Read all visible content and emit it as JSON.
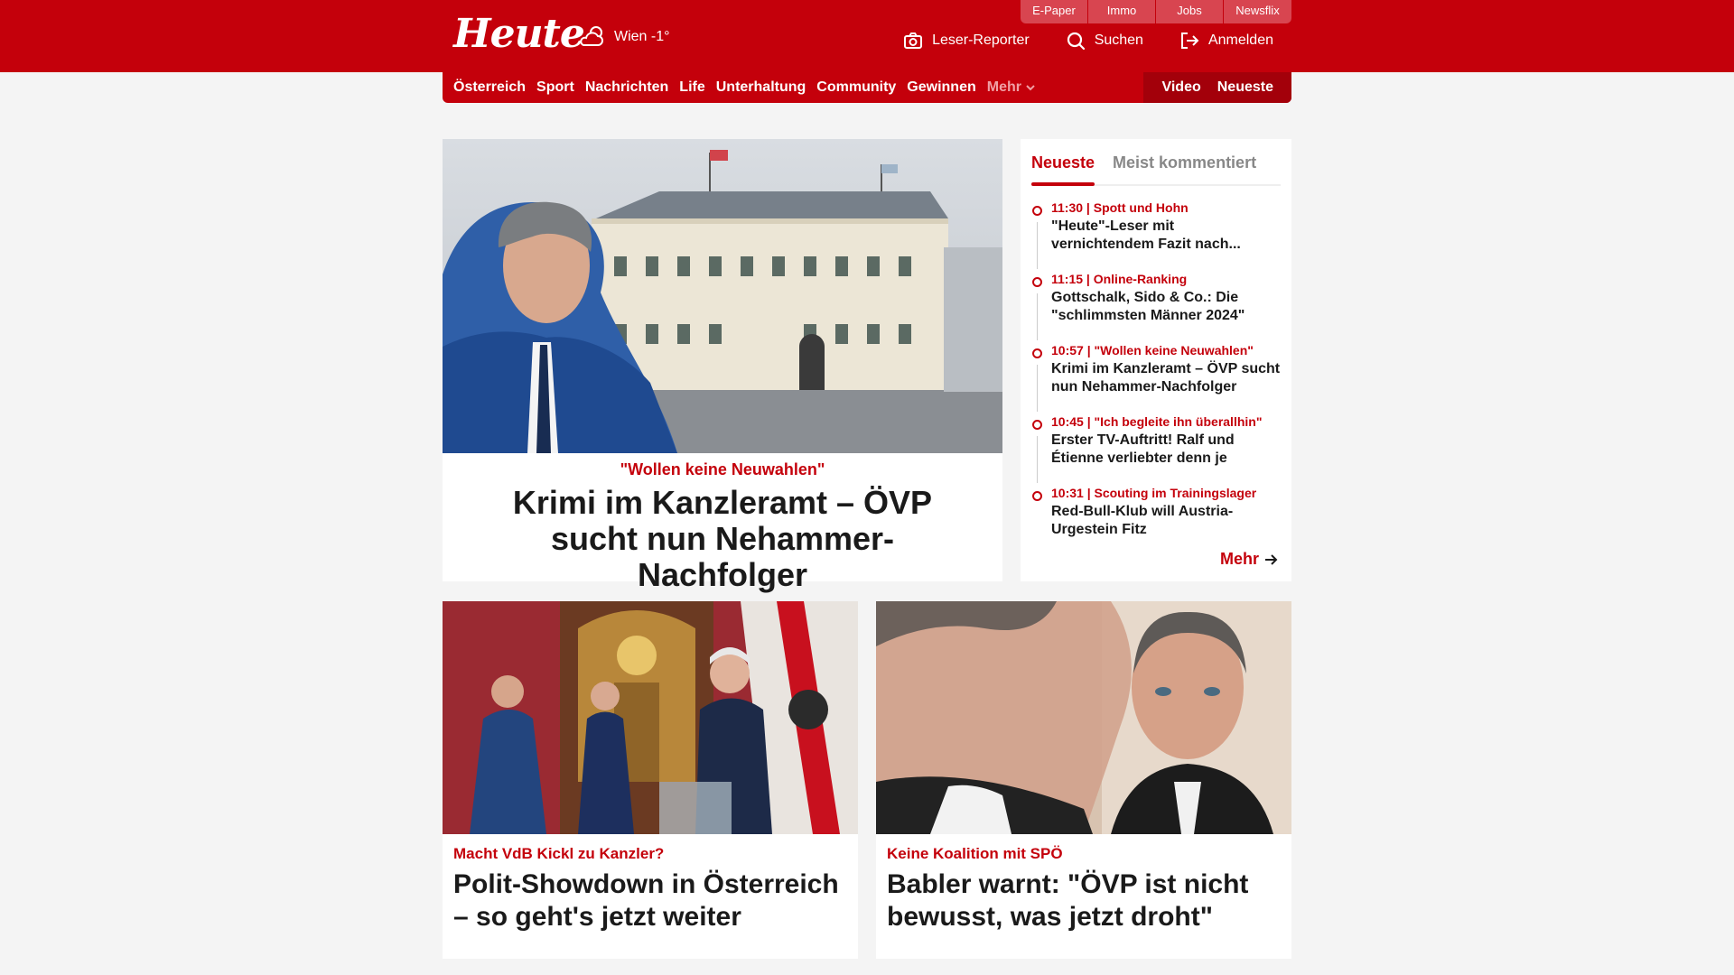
{
  "brand": {
    "logo": "Heute",
    "weather": "Wien -1°"
  },
  "quicklinks": [
    "E-Paper",
    "Immo",
    "Jobs",
    "Newsflix"
  ],
  "actions": {
    "reporter": "Leser-Reporter",
    "search": "Suchen",
    "login": "Anmelden"
  },
  "nav": {
    "items": [
      "Österreich",
      "Sport",
      "Nachrichten",
      "Life",
      "Unterhaltung",
      "Community",
      "Gewinnen"
    ],
    "more": "Mehr",
    "video": "Video",
    "latest": "Neueste"
  },
  "hero": {
    "kicker": "\"Wollen keine Neuwahlen\"",
    "title": "Krimi im Kanzleramt – ÖVP sucht nun Nehammer-Nachfolger"
  },
  "sidebar": {
    "tabs": [
      "Neueste",
      "Meist kommentiert"
    ],
    "items": [
      {
        "meta": "11:30 | Spott und Hohn",
        "headline": "\"Heute\"-Leser mit vernichtendem Fazit nach..."
      },
      {
        "meta": "11:15 | Online-Ranking",
        "headline": "Gottschalk, Sido & Co.: Die \"schlimmsten Männer 2024\""
      },
      {
        "meta": "10:57 | \"Wollen keine Neuwahlen\"",
        "headline": "Krimi im Kanzleramt – ÖVP sucht nun Nehammer-Nachfolger"
      },
      {
        "meta": "10:45 | \"Ich begleite ihn überallhin\"",
        "headline": "Erster TV-Auftritt! Ralf und Étienne verliebter denn je"
      },
      {
        "meta": "10:31 | Scouting im Trainingslager",
        "headline": "Red-Bull-Klub will Austria-Urgestein Fitz"
      }
    ],
    "more": "Mehr"
  },
  "cards": [
    {
      "kicker": "Macht VdB Kickl zu Kanzler?",
      "title": "Polit-Showdown in Österreich – so geht's jetzt weiter"
    },
    {
      "kicker": "Keine Koalition mit SPÖ",
      "title": "Babler warnt: \"ÖVP ist nicht bewusst, was jetzt droht\""
    }
  ],
  "colors": {
    "brand_red": "#c4000b",
    "background": "#f4f4f4"
  }
}
